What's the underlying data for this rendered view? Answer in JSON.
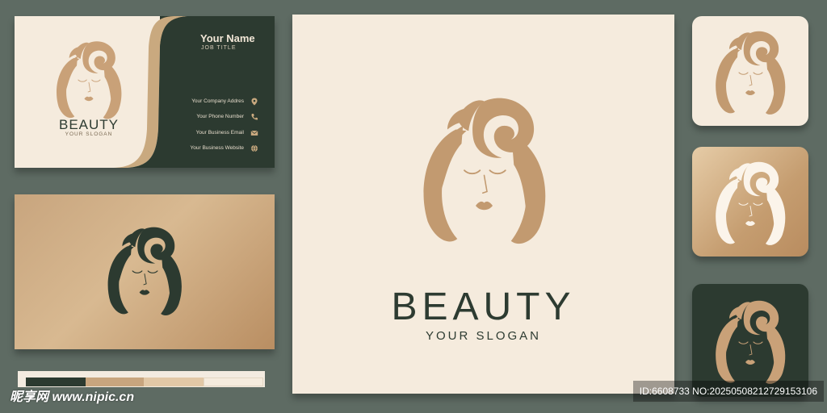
{
  "business_card": {
    "name": "Your Name",
    "job_title": "JOB TITLE",
    "contacts": [
      {
        "label": "Your Company Addres",
        "icon": "location-pin-icon"
      },
      {
        "label": "Your Phone Number",
        "icon": "phone-icon"
      },
      {
        "label": "Your Business Email",
        "icon": "email-icon"
      },
      {
        "label": "Your Business Website",
        "icon": "globe-icon"
      }
    ],
    "brand": "BEAUTY",
    "slogan": "YOUR SLOGAN"
  },
  "main_logo": {
    "brand": "BEAUTY",
    "slogan": "YOUR SLOGAN"
  },
  "palette": {
    "background": "#5e6b63",
    "cream": "#f5ebdd",
    "dark_green": "#2c3a30",
    "gold": "#c8a57e",
    "swatches": [
      "#2c3a30",
      "#c8a57e",
      "#e2c8a6",
      "#f5ebdd"
    ]
  },
  "watermark": {
    "left": "昵享网 www.nipic.cn",
    "right": "ID:6608733 NO:20250508212729153106"
  }
}
